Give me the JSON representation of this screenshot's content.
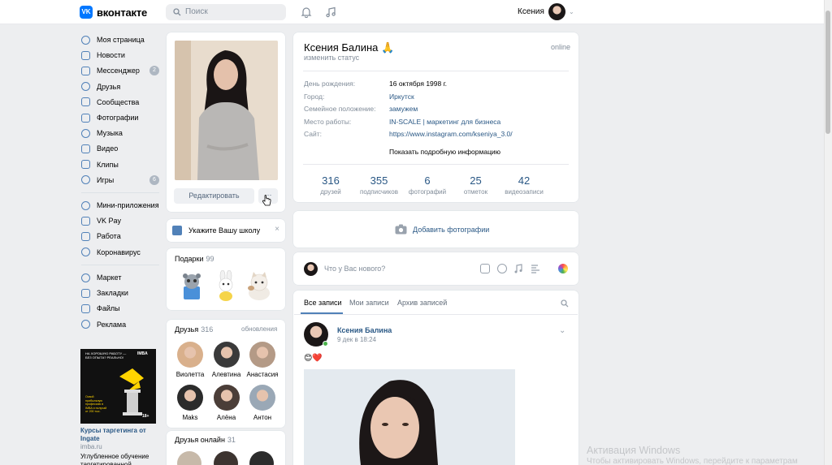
{
  "header": {
    "logo_text": "вконтакте",
    "search_placeholder": "Поиск",
    "user_name": "Ксения"
  },
  "menu": {
    "items": [
      {
        "label": "Моя страница",
        "icon": "user-circle-icon"
      },
      {
        "label": "Новости",
        "icon": "news-icon"
      },
      {
        "label": "Мессенджер",
        "icon": "message-icon",
        "badge": "2"
      },
      {
        "label": "Друзья",
        "icon": "friends-icon"
      },
      {
        "label": "Сообщества",
        "icon": "communities-icon"
      },
      {
        "label": "Фотографии",
        "icon": "photo-icon"
      },
      {
        "label": "Музыка",
        "icon": "music-icon"
      },
      {
        "label": "Видео",
        "icon": "video-icon"
      },
      {
        "label": "Клипы",
        "icon": "clips-icon"
      },
      {
        "label": "Игры",
        "icon": "games-icon",
        "badge": "6"
      }
    ],
    "items2": [
      {
        "label": "Мини-приложения",
        "icon": "apps-icon"
      },
      {
        "label": "VK Pay",
        "icon": "vkpay-icon"
      },
      {
        "label": "Работа",
        "icon": "work-icon"
      },
      {
        "label": "Коронавирус",
        "icon": "virus-icon"
      }
    ],
    "items3": [
      {
        "label": "Маркет",
        "icon": "market-icon"
      },
      {
        "label": "Закладки",
        "icon": "bookmark-icon"
      },
      {
        "label": "Файлы",
        "icon": "files-icon"
      },
      {
        "label": "Реклама",
        "icon": "ads-icon"
      }
    ]
  },
  "ad": {
    "banner_text": "НА ХОРОШУЮ РАБОТУ — БЕЗ ОПЫТА? РЕАЛЬНО!",
    "banner_brand": "IMBA",
    "banner_small": "Освой прибыльную профессию в IMBA и получай от 200 тыс.",
    "banner_age": "18+",
    "title": "Курсы таргетинга от Ingate",
    "domain": "imba.ru",
    "desc": "Углубленное обучение таргетированной"
  },
  "profile_card": {
    "edit_label": "Редактировать",
    "more_label": "···"
  },
  "school": {
    "label": "Укажите Вашу школу",
    "close": "×"
  },
  "gifts": {
    "title": "Подарки",
    "count": "99"
  },
  "friends": {
    "title": "Друзья",
    "count": "316",
    "updates": "обновления",
    "list": [
      {
        "name": "Виолетта"
      },
      {
        "name": "Алевтина"
      },
      {
        "name": "Анастасия"
      },
      {
        "name": "Maks"
      },
      {
        "name": "Алёна"
      },
      {
        "name": "Антон"
      }
    ]
  },
  "friends_online": {
    "title": "Друзья онлайн",
    "count": "31"
  },
  "profile": {
    "name": "Ксения Балина 🙏",
    "status": "изменить статус",
    "online": "online",
    "info": [
      {
        "label": "День рождения:",
        "value": "16 октября 1998 г."
      },
      {
        "label": "Город:",
        "value": "Иркутск"
      },
      {
        "label": "Семейное положение:",
        "value": "замужем"
      },
      {
        "label": "Место работы:",
        "value": "IN-SCALE | маркетинг для бизнеса"
      },
      {
        "label": "Сайт:",
        "value": "https://www.instagram.com/kseniya_3.0/"
      }
    ],
    "more_info": "Показать подробную информацию",
    "stats": [
      {
        "n": "316",
        "l": "друзей"
      },
      {
        "n": "355",
        "l": "подписчиков"
      },
      {
        "n": "6",
        "l": "фотографий"
      },
      {
        "n": "25",
        "l": "отметок"
      },
      {
        "n": "42",
        "l": "видеозаписи"
      }
    ]
  },
  "add_photo": "Добавить фотографии",
  "composer_placeholder": "Что у Вас нового?",
  "wall": {
    "tabs": [
      "Все записи",
      "Мои записи",
      "Архив записей"
    ]
  },
  "post": {
    "author": "Ксения Балина",
    "date": "9 дек в 18:24",
    "emoji": "😊❤️"
  },
  "watermark": {
    "line1": "Активация Windows",
    "line2": "Чтобы активировать Windows, перейдите к параметрам"
  }
}
